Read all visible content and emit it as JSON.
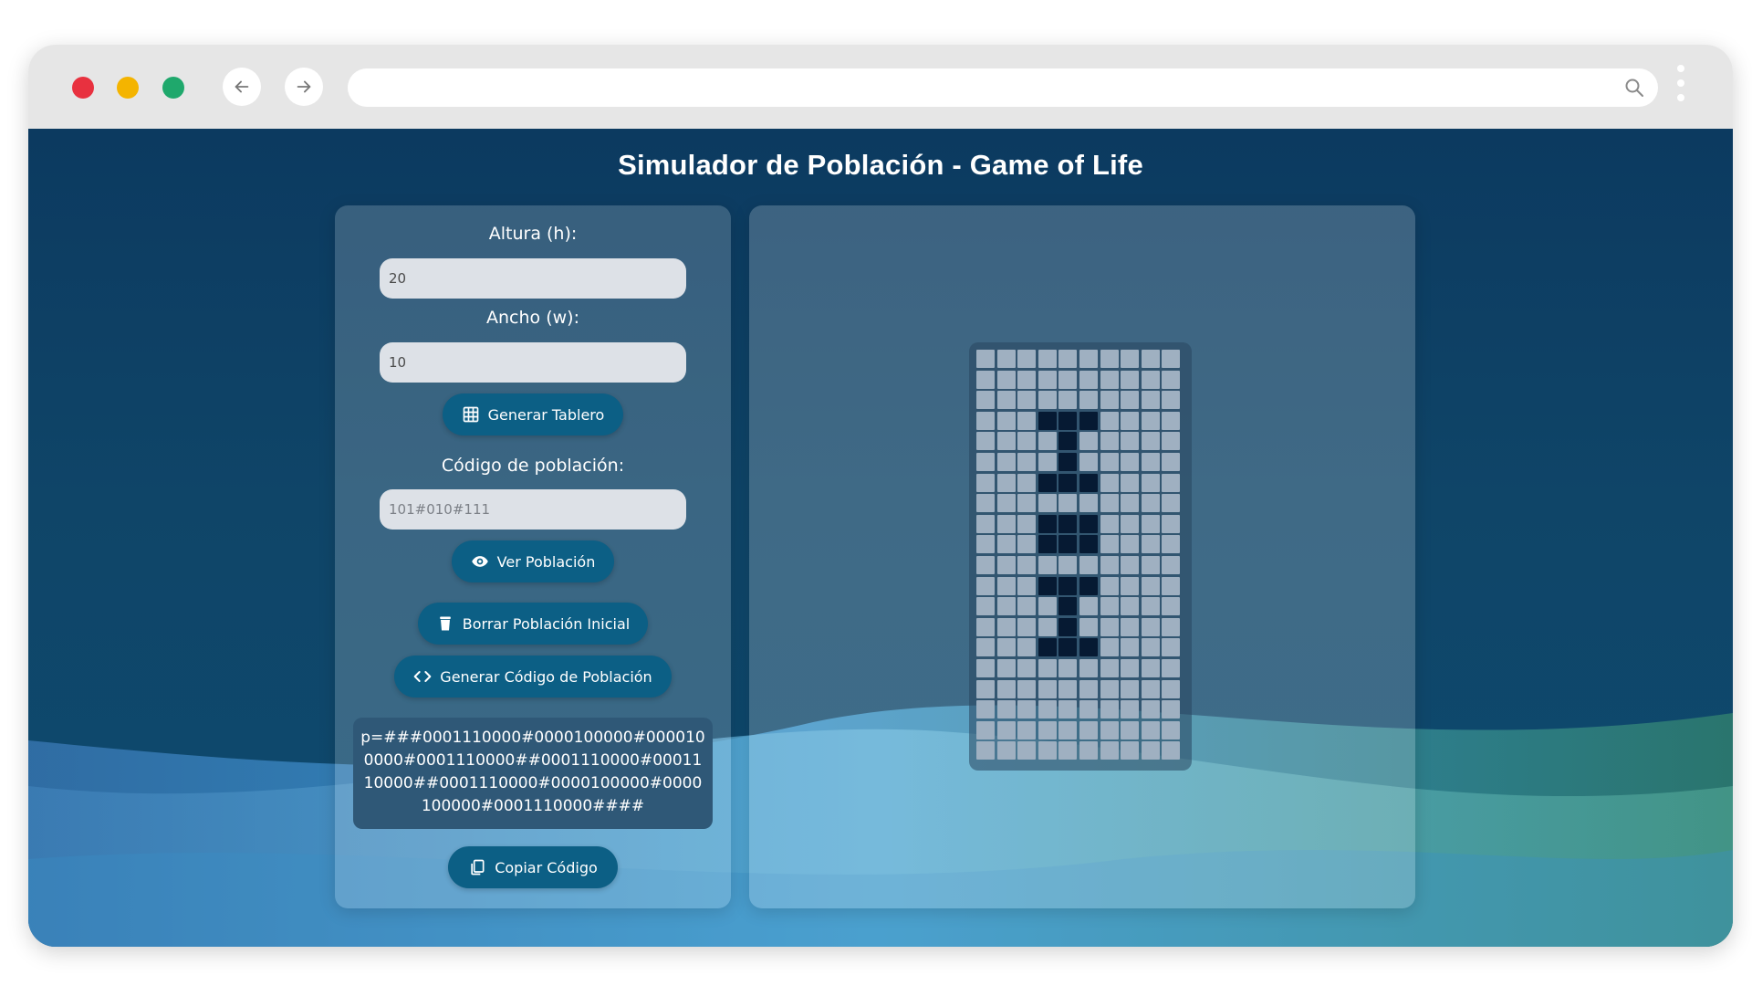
{
  "page": {
    "title": "Simulador de Población - Game of Life"
  },
  "browser": {
    "address_value": ""
  },
  "controls": {
    "height_label": "Altura (h):",
    "height_value": "20",
    "width_label": "Ancho (w):",
    "width_value": "10",
    "generate_board_label": "Generar Tablero",
    "population_code_label": "Código de población:",
    "population_code_placeholder": "101#010#111",
    "view_population_label": "Ver Población",
    "clear_population_label": "Borrar Población Inicial",
    "generate_code_label": "Generar Código de Población",
    "generated_code": "p=###0001110000#0000100000#0000100000#0001110000##0001110000#0001110000##0001110000#0000100000#0000100000#0001110000####",
    "copy_code_label": "Copiar Código"
  },
  "board": {
    "rows": 20,
    "cols": 10,
    "cells": [
      "0000000000",
      "0000000000",
      "0000000000",
      "0001110000",
      "0000100000",
      "0000100000",
      "0001110000",
      "0000000000",
      "0001110000",
      "0001110000",
      "0000000000",
      "0001110000",
      "0000100000",
      "0000100000",
      "0001110000",
      "0000000000",
      "0000000000",
      "0000000000",
      "0000000000",
      "0000000000"
    ],
    "alive_color": "#061a33",
    "dead_color": "#9fb0c1"
  },
  "icons": {
    "back": "arrow-left-icon",
    "forward": "arrow-right-icon",
    "search": "search-icon",
    "menu": "kebab-menu-icon",
    "generate_board": "grid-icon",
    "view_population": "eye-icon",
    "clear_population": "trash-icon",
    "generate_code": "code-icon",
    "copy_code": "copy-icon"
  },
  "colors": {
    "accent_button": "#0c5f85",
    "page_background": "#0c3a60"
  }
}
